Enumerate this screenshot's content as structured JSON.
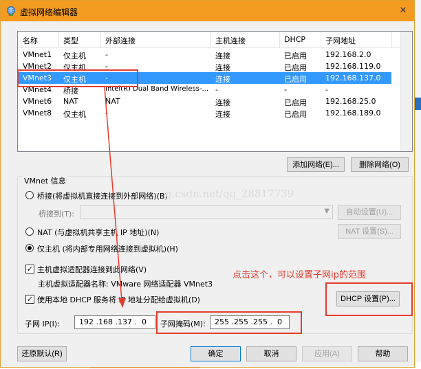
{
  "window": {
    "title": "虚拟网络编辑器",
    "close_glyph": "✕"
  },
  "network_list": {
    "columns": [
      "名称",
      "类型",
      "外部连接",
      "主机连接",
      "DHCP",
      "子网地址"
    ],
    "rows": [
      {
        "name": "VMnet1",
        "type": "仅主机",
        "external": "-",
        "host": "连接",
        "dhcp": "已启用",
        "subnet": "192.168.2.0",
        "selected": false
      },
      {
        "name": "VMnet2",
        "type": "仅主机",
        "external": "-",
        "host": "连接",
        "dhcp": "已启用",
        "subnet": "192.168.119.0",
        "selected": false
      },
      {
        "name": "VMnet3",
        "type": "仅主机",
        "external": "-",
        "host": "连接",
        "dhcp": "已启用",
        "subnet": "192.168.137.0",
        "selected": true
      },
      {
        "name": "VMnet4",
        "type": "桥接",
        "external": "Intel(R) Dual Band Wireless-...",
        "host": "-",
        "dhcp": "-",
        "subnet": "-",
        "selected": false
      },
      {
        "name": "VMnet6",
        "type": "NAT",
        "external": "NAT",
        "host": "连接",
        "dhcp": "已启用",
        "subnet": "192.168.25.0",
        "selected": false
      },
      {
        "name": "VMnet8",
        "type": "仅主机",
        "external": "-",
        "host": "连接",
        "dhcp": "已启用",
        "subnet": "192.168.189.0",
        "selected": false
      }
    ]
  },
  "list_buttons": {
    "add": "添加网络(E)...",
    "remove": "删除网络(O)"
  },
  "vmnet_info": {
    "group_label": "VMnet 信息",
    "bridged_label": "桥接(将虚拟机直接连接到外部网络)(B)",
    "bridged_to_label": "桥接到(T):",
    "auto_settings": "自动设置(U)...",
    "nat_label": "NAT (与虚拟机共享主机 IP 地址)(N)",
    "nat_settings": "NAT 设置(S)...",
    "host_only_label": "仅主机 (将内部专用网络连接到虚拟机)(H)",
    "selected_mode": "host_only",
    "connect_adapter_label": "主机虚拟适配器连接到此网络(V)",
    "connect_adapter_checked": true,
    "adapter_name_label": "主机虚拟适配器名称: VMware 网络适配器 VMnet3",
    "use_dhcp_label": "使用本地 DHCP 服务将 IP 地址分配给虚拟机(D)",
    "use_dhcp_checked": true,
    "dhcp_settings": "DHCP 设置(P)...",
    "subnet_ip_label": "子网 IP(I):",
    "subnet_ip_value": "192 .168 .137 .  0",
    "subnet_mask_label": "子网掩码(M):",
    "subnet_mask_value": "255 .255 .255 .  0"
  },
  "bottom_buttons": {
    "restore": "还原默认(R)",
    "ok": "确定",
    "cancel": "取消",
    "apply": "应用(A)",
    "help": "帮助"
  },
  "annotation": {
    "text": "点击这个，可以设置子网ip的范围",
    "color": "#e53c2e"
  },
  "watermark": "g.csdn.net/qq_28817739",
  "colors": {
    "titlebar": "#f49b21",
    "selection": "#3399ff",
    "annotation": "#e53c2e"
  }
}
